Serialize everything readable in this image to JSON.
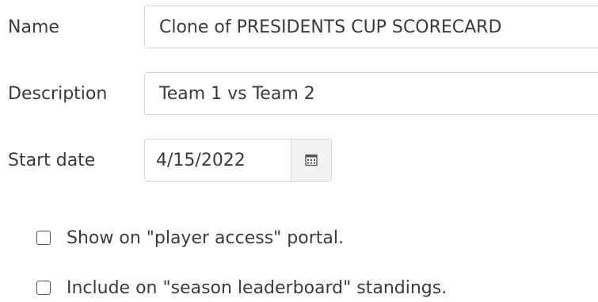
{
  "form": {
    "name": {
      "label": "Name",
      "value": "Clone of PRESIDENTS CUP SCORECARD"
    },
    "description": {
      "label": "Description",
      "value": "Team 1 vs Team 2"
    },
    "start_date": {
      "label": "Start date",
      "value": "4/15/2022",
      "button_icon": "calendar-icon"
    },
    "options": [
      {
        "label": "Show on \"player access\" portal.",
        "checked": false
      },
      {
        "label": "Include on \"season leaderboard\" standings.",
        "checked": false
      }
    ]
  }
}
